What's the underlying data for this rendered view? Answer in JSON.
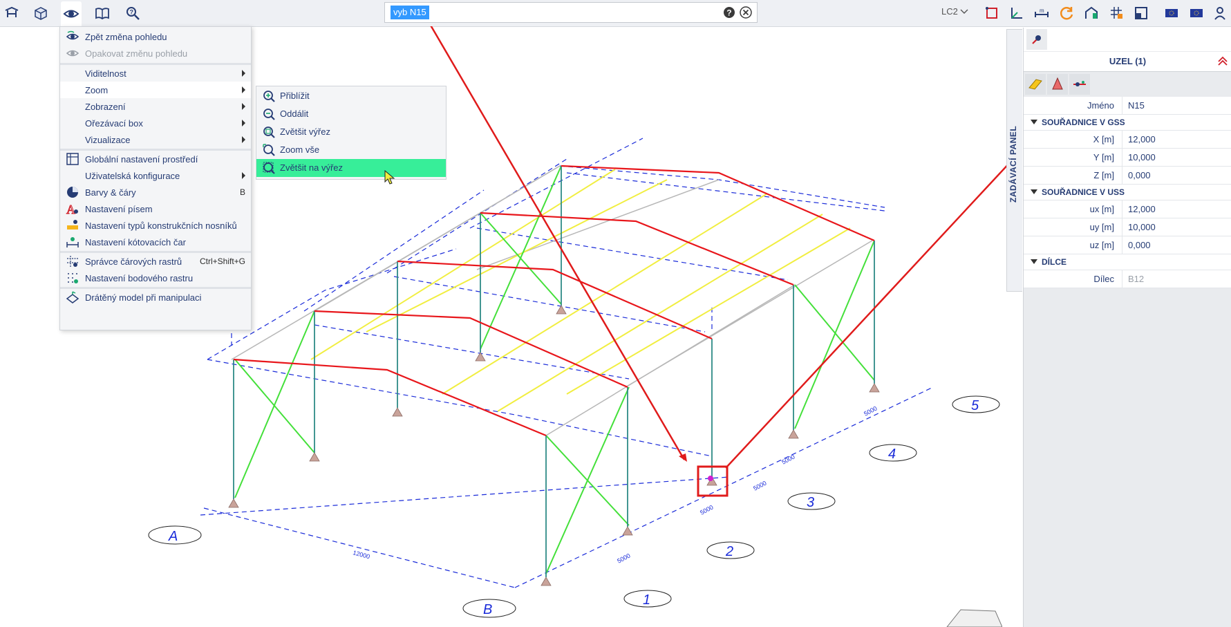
{
  "toolbar": {
    "left_icons": [
      "structure-icon",
      "3d-view-icon",
      "eye-icon",
      "book-icon",
      "search-help-icon"
    ],
    "right_icons": [
      "rectangle-icon",
      "axis-icon",
      "dimension-icon",
      "refresh-icon",
      "house-icon",
      "grid-icon",
      "frame-icon",
      "flag-icon",
      "flag-icon",
      "user-icon"
    ],
    "load_case": "LC2"
  },
  "search": {
    "value": "vyb N15",
    "placeholder": ""
  },
  "view_menu": {
    "items": [
      {
        "label": "Zpět změna pohledu",
        "icon": "undo-view-icon",
        "disabled": false
      },
      {
        "label": "Opakovat změnu pohledu",
        "icon": "redo-view-icon",
        "disabled": true
      },
      {
        "label": "Viditelnost",
        "submenu": true
      },
      {
        "label": "Zoom",
        "submenu": true,
        "active": true
      },
      {
        "label": "Zobrazení",
        "submenu": true
      },
      {
        "label": "Ořezávací box",
        "submenu": true
      },
      {
        "label": "Vizualizace",
        "submenu": true
      },
      {
        "label": "Globální nastavení prostředí",
        "icon": "global-settings-icon"
      },
      {
        "label": "Uživatelská konfigurace",
        "submenu": true
      },
      {
        "label": "Barvy & čáry",
        "icon": "colors-icon",
        "shortcut": "B"
      },
      {
        "label": "Nastavení písem",
        "icon": "font-icon"
      },
      {
        "label": "Nastavení typů konstrukčních nosníků",
        "icon": "beam-type-icon"
      },
      {
        "label": "Nastavení kótovacích čar",
        "icon": "dimension-line-icon"
      },
      {
        "label": "Správce čárových rastrů",
        "icon": "line-grid-icon",
        "shortcut": "Ctrl+Shift+G"
      },
      {
        "label": "Nastavení bodového rastru",
        "icon": "point-grid-icon"
      },
      {
        "label": "Drátěný model při manipulaci",
        "icon": "wireframe-icon"
      }
    ]
  },
  "zoom_submenu": {
    "items": [
      {
        "label": "Přiblížit",
        "icon": "zoom-in-icon"
      },
      {
        "label": "Oddálit",
        "icon": "zoom-out-icon"
      },
      {
        "label": "Zvětšit výřez",
        "icon": "zoom-window-icon"
      },
      {
        "label": "Zoom vše",
        "icon": "zoom-all-icon"
      },
      {
        "label": "Zvětšit na výřez",
        "icon": "zoom-selection-icon",
        "highlighted": true
      }
    ]
  },
  "side_tab": {
    "label": "ZADÁVACÍ PANEL"
  },
  "properties": {
    "title": "UZEL (1)",
    "name_label": "Jméno",
    "name_value": "N15",
    "gss_section": "SOUŘADNICE V GSS",
    "gss": [
      {
        "label": "X [m]",
        "value": "12,000"
      },
      {
        "label": "Y [m]",
        "value": "10,000"
      },
      {
        "label": "Z [m]",
        "value": "0,000"
      }
    ],
    "uss_section": "SOUŘADNICE V USS",
    "uss": [
      {
        "label": "ux [m]",
        "value": "12,000"
      },
      {
        "label": "uy [m]",
        "value": "10,000"
      },
      {
        "label": "uz [m]",
        "value": "0,000"
      }
    ],
    "parts_section": "DÍLCE",
    "part_label": "Dílec",
    "part_value": "B12"
  },
  "grid": {
    "letters": [
      "A",
      "B"
    ],
    "numbers": [
      "1",
      "2",
      "3",
      "4",
      "5"
    ],
    "dim_long": "12000",
    "dim_short": [
      "5000",
      "5000",
      "5000",
      "5000",
      "5000"
    ]
  },
  "colors": {
    "rafter": "#e8161b",
    "purlin": "#f1ee40",
    "bracing": "#44e03a",
    "column": "#2d8a86",
    "grid": "#1a2bd9",
    "highlight": "#37ee99",
    "annotation": "#e01b1b"
  }
}
